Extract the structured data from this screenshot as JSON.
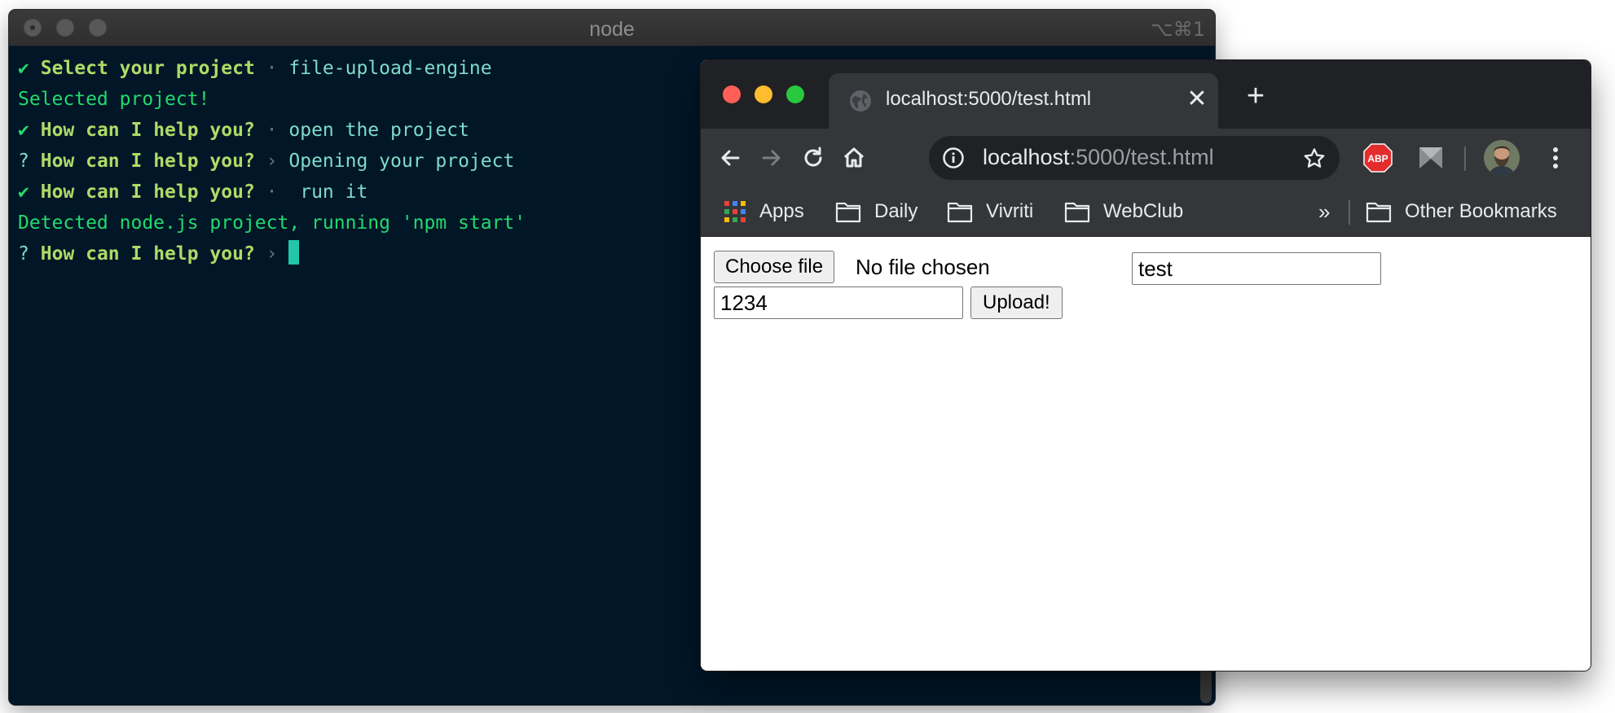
{
  "terminal": {
    "title": "node",
    "shortcut": "⌥⌘1",
    "lines": [
      {
        "check": "✔",
        "label": "Select your project",
        "sep": " · ",
        "value": "file-upload-engine"
      },
      {
        "text": "Selected project!"
      },
      {
        "check": "✔",
        "label": "How can I help you?",
        "sep": " · ",
        "value": "open the project"
      },
      {
        "check": "?",
        "label": "How can I help you?",
        "sep": " › ",
        "value": "Opening your project"
      },
      {
        "check": "✔",
        "label": "How can I help you?",
        "sep": " ·  ",
        "value": "run it"
      },
      {
        "text": "Detected node.js project, running 'npm start'"
      },
      {
        "check": "?",
        "label": "How can I help you?",
        "sep": " › ",
        "value": ""
      }
    ]
  },
  "browser": {
    "tab": {
      "title": "localhost:5000/test.html",
      "favicon": "globe-icon",
      "close": "✕"
    },
    "new_tab": "+",
    "omnibox": {
      "host": "localhost",
      "rest": ":5000/test.html"
    },
    "bookmarks": {
      "apps": "Apps",
      "items": [
        "Daily",
        "Vivriti",
        "WebClub"
      ],
      "overflow": "»",
      "other": "Other Bookmarks"
    },
    "extensions": {
      "abp": "ABP"
    }
  },
  "page": {
    "choose_file": "Choose file",
    "no_file": "No file chosen",
    "name_value": "test",
    "number_value": "1234",
    "upload": "Upload!"
  },
  "colors": {
    "terminal_bg": "#011627",
    "terminal_green": "#22da6e",
    "terminal_teal": "#7fdbca",
    "cursor": "#21c7a8",
    "browser_chrome": "#35363a",
    "browser_tabbar": "#202124"
  }
}
